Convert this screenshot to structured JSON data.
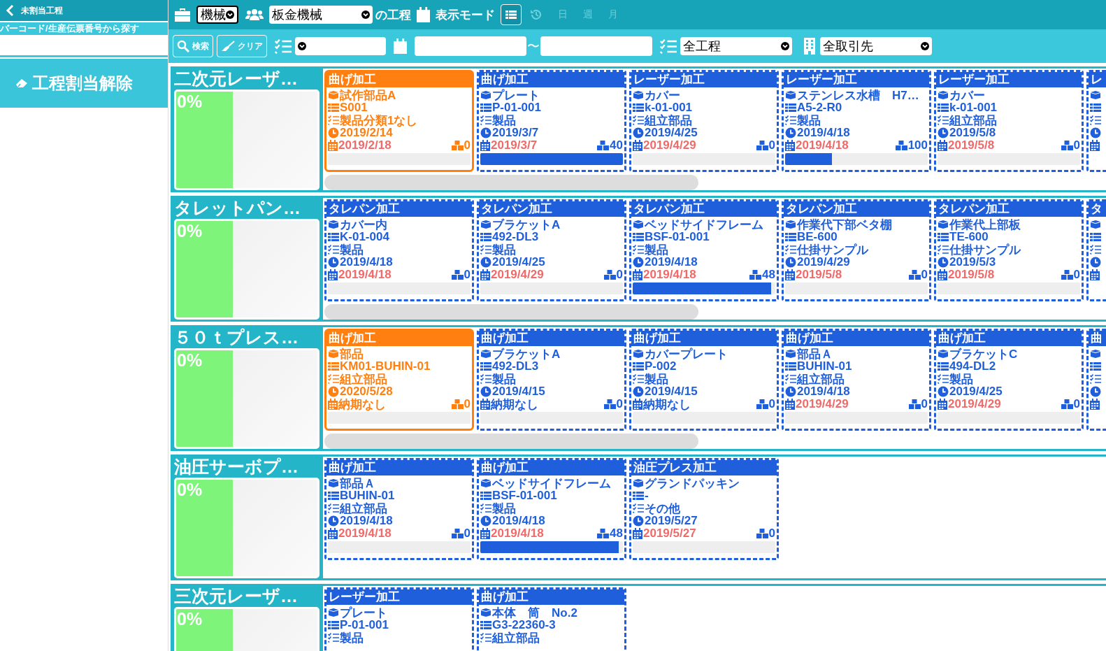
{
  "sidebar": {
    "title": "未割当工程",
    "search_label": "バーコード/生産伝票番号から探す",
    "unassign_button": "工程割当解除"
  },
  "toolbar": {
    "type_select": "機械",
    "group_select": "板金機械",
    "suffix": "の工程",
    "mode_label": "表示モード",
    "view_list": {
      "selected": true
    },
    "views": [
      {
        "label": "日",
        "disabled": true
      },
      {
        "label": "週",
        "disabled": true
      },
      {
        "label": "月",
        "disabled": true
      }
    ]
  },
  "filters": {
    "search_button": "検索",
    "clear_button": "クリア",
    "range_sep": "〜",
    "process_select": "全工程",
    "customer_select": "全取引先"
  },
  "groups": [
    {
      "name": "二次元レーザ…",
      "progress": "0%",
      "level": 0.4,
      "scrollbar": true,
      "cards": [
        {
          "kind": "selected",
          "process": "曲げ加工",
          "name": "試作部品A",
          "code": "S001",
          "category": "製品分類1なし",
          "start": "2019/2/14",
          "due": "2019/2/18",
          "late": true,
          "qty": "0",
          "level": 0
        },
        {
          "kind": "normal",
          "process": "曲げ加工",
          "name": "プレート",
          "code": "P-01-001",
          "category": "製品",
          "start": "2019/3/7",
          "due": "2019/3/7",
          "late": true,
          "qty": "40",
          "level": 1
        },
        {
          "kind": "normal",
          "process": "レーザー加工",
          "name": "カバー",
          "code": "k-01-001",
          "category": "組立部品",
          "start": "2019/4/25",
          "due": "2019/4/29",
          "late": true,
          "qty": "0",
          "level": 0
        },
        {
          "kind": "normal",
          "process": "レーザー加工",
          "name": "ステンレス水槽　H7…",
          "code": "A5-2-R0",
          "category": "製品",
          "start": "2019/4/18",
          "due": "2019/4/18",
          "late": true,
          "qty": "100",
          "level": 0.33
        },
        {
          "kind": "normal",
          "process": "レーザー加工",
          "name": "カバー",
          "code": "k-01-001",
          "category": "組立部品",
          "start": "2019/5/8",
          "due": "2019/5/8",
          "late": true,
          "qty": "0",
          "level": 0
        },
        {
          "kind": "partial",
          "process": "レ"
        }
      ]
    },
    {
      "name": "タレットパン…",
      "progress": "0%",
      "level": 0.4,
      "scrollbar": true,
      "cards": [
        {
          "kind": "normal",
          "process": "タレパン加工",
          "name": "カバー内",
          "code": "K-01-004",
          "category": "製品",
          "start": "2019/4/18",
          "due": "2019/4/18",
          "late": true,
          "qty": "0",
          "level": 0
        },
        {
          "kind": "normal",
          "process": "タレパン加工",
          "name": "ブラケットA",
          "code": "492-DL3",
          "category": "製品",
          "start": "2019/4/25",
          "due": "2019/4/29",
          "late": true,
          "qty": "0",
          "level": 0
        },
        {
          "kind": "normal",
          "process": "タレパン加工",
          "name": "ベッドサイドフレーム",
          "code": "BSF-01-001",
          "category": "製品",
          "start": "2019/4/18",
          "due": "2019/4/18",
          "late": true,
          "qty": "48",
          "level": 0.97
        },
        {
          "kind": "normal",
          "process": "タレパン加工",
          "name": "作業代下部ベタ棚",
          "code": "BE-600",
          "category": "仕掛サンプル",
          "start": "2019/4/29",
          "due": "2019/5/8",
          "late": true,
          "qty": "0",
          "level": 0
        },
        {
          "kind": "normal",
          "process": "タレパン加工",
          "name": "作業代上部板",
          "code": "TE-600",
          "category": "仕掛サンプル",
          "start": "2019/5/3",
          "due": "2019/5/8",
          "late": true,
          "qty": "0",
          "level": 0
        },
        {
          "kind": "partial",
          "process": "タ"
        }
      ]
    },
    {
      "name": "５０ｔプレス…",
      "progress": "0%",
      "level": 0.4,
      "scrollbar": true,
      "cards": [
        {
          "kind": "selected",
          "process": "曲げ加工",
          "name": "部品",
          "code": "KM01-BUHIN-01",
          "category": "組立部品",
          "start": "2020/5/28",
          "due": "納期なし",
          "late": false,
          "qty": "0",
          "level": 0
        },
        {
          "kind": "normal",
          "process": "曲げ加工",
          "name": "ブラケットA",
          "code": "492-DL3",
          "category": "製品",
          "start": "2019/4/15",
          "due": "納期なし",
          "late": false,
          "qty": "0",
          "level": 0
        },
        {
          "kind": "normal",
          "process": "曲げ加工",
          "name": "カバープレート",
          "code": "P-002",
          "category": "製品",
          "start": "2019/4/15",
          "due": "納期なし",
          "late": false,
          "qty": "0",
          "level": 0
        },
        {
          "kind": "normal",
          "process": "曲げ加工",
          "name": "部品Ａ",
          "code": "BUHIN-01",
          "category": "組立部品",
          "start": "2019/4/18",
          "due": "2019/4/29",
          "late": true,
          "qty": "0",
          "level": 0
        },
        {
          "kind": "normal",
          "process": "曲げ加工",
          "name": "ブラケットC",
          "code": "494-DL2",
          "category": "製品",
          "start": "2019/4/25",
          "due": "2019/4/29",
          "late": true,
          "qty": "0",
          "level": 0
        },
        {
          "kind": "partial",
          "process": "曲"
        }
      ]
    },
    {
      "name": "油圧サーボプ…",
      "progress": "0%",
      "level": 0.4,
      "cards": [
        {
          "kind": "normal",
          "process": "曲げ加工",
          "name": "部品Ａ",
          "code": "BUHIN-01",
          "category": "組立部品",
          "start": "2019/4/18",
          "due": "2019/4/18",
          "late": true,
          "qty": "0",
          "level": 0
        },
        {
          "kind": "normal",
          "process": "曲げ加工",
          "name": "ベッドサイドフレーム",
          "code": "BSF-01-001",
          "category": "製品",
          "start": "2019/4/18",
          "due": "2019/4/18",
          "late": true,
          "qty": "48",
          "level": 0.97
        },
        {
          "kind": "normal",
          "process": "油圧プレス加工",
          "name": "グランドパッキン",
          "code": "-",
          "category": "その他",
          "start": "2019/5/27",
          "due": "2019/5/27",
          "late": true,
          "qty": "0",
          "level": 0
        }
      ]
    },
    {
      "name": "三次元レーザ…",
      "progress": "0%",
      "level": 0.4,
      "cards": [
        {
          "kind": "cut",
          "process": "レーザー加工",
          "name": "プレート",
          "code": "P-01-001",
          "category": "製品"
        },
        {
          "kind": "cut",
          "process": "曲げ加工",
          "name": "本体　筒　No.2",
          "code": "G3-22360-3",
          "category": "組立部品"
        }
      ]
    }
  ]
}
